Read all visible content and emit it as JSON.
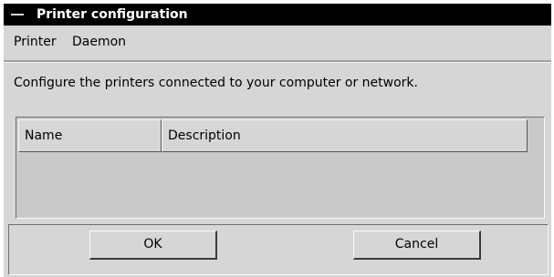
{
  "window": {
    "title": "Printer configuration"
  },
  "menubar": {
    "items": [
      "Printer",
      "Daemon"
    ]
  },
  "instruction": "Configure the printers connected to your computer or network.",
  "printer_list": {
    "columns": [
      "Name",
      "Description"
    ],
    "rows": []
  },
  "buttons": {
    "ok": "OK",
    "cancel": "Cancel"
  },
  "icons": {
    "window_menu": "dash-icon"
  }
}
